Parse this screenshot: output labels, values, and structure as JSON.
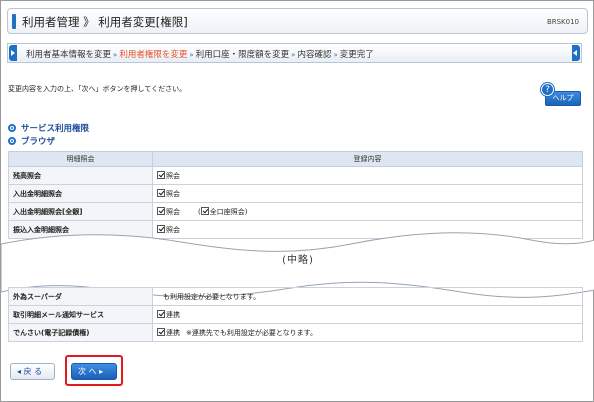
{
  "header": {
    "title": "利用者管理 》 利用者変更[権限]",
    "screen_code": "BRSK010"
  },
  "steps": [
    {
      "label": "利用者基本情報を変更",
      "current": false
    },
    {
      "label": "利用者権限を変更",
      "current": true
    },
    {
      "label": "利用口座・限度額を変更",
      "current": false
    },
    {
      "label": "内容確認",
      "current": false
    },
    {
      "label": "変更完了",
      "current": false
    }
  ],
  "step_separator": "»",
  "instructions": "変更内容を入力の上、「次へ」ボタンを押してください。",
  "help": {
    "icon": "?",
    "label": "ヘルプ"
  },
  "sections": {
    "service": "サービス利用権限",
    "browser": "ブラウザ"
  },
  "table": {
    "headers": [
      "明細照会",
      "登録内容"
    ],
    "rows": [
      {
        "label": "残高照会",
        "check": "照会",
        "extra": "",
        "note": ""
      },
      {
        "label": "入出金明細照会",
        "check": "照会",
        "extra": "",
        "note": ""
      },
      {
        "label": "入出金明細照会[全銀]",
        "check": "照会",
        "extra": "全口座照会",
        "note": ""
      },
      {
        "label": "振込入金明細照会",
        "check": "照会",
        "extra": "",
        "note": ""
      }
    ],
    "rows_after": [
      {
        "label": "外為スーパーダ",
        "check": "",
        "extra": "",
        "note": "も利用設定が必要となります。"
      },
      {
        "label": "取引明細メール通知サービス",
        "check": "連携",
        "extra": "",
        "note": ""
      },
      {
        "label": "でんさい(電子記録債権)",
        "check": "連携",
        "extra": "",
        "note": "※連携先でも利用設定が必要となります。"
      }
    ]
  },
  "omission_label": "(中略)",
  "buttons": {
    "back": "◂ 戻 る",
    "next": "次 へ ▸"
  }
}
